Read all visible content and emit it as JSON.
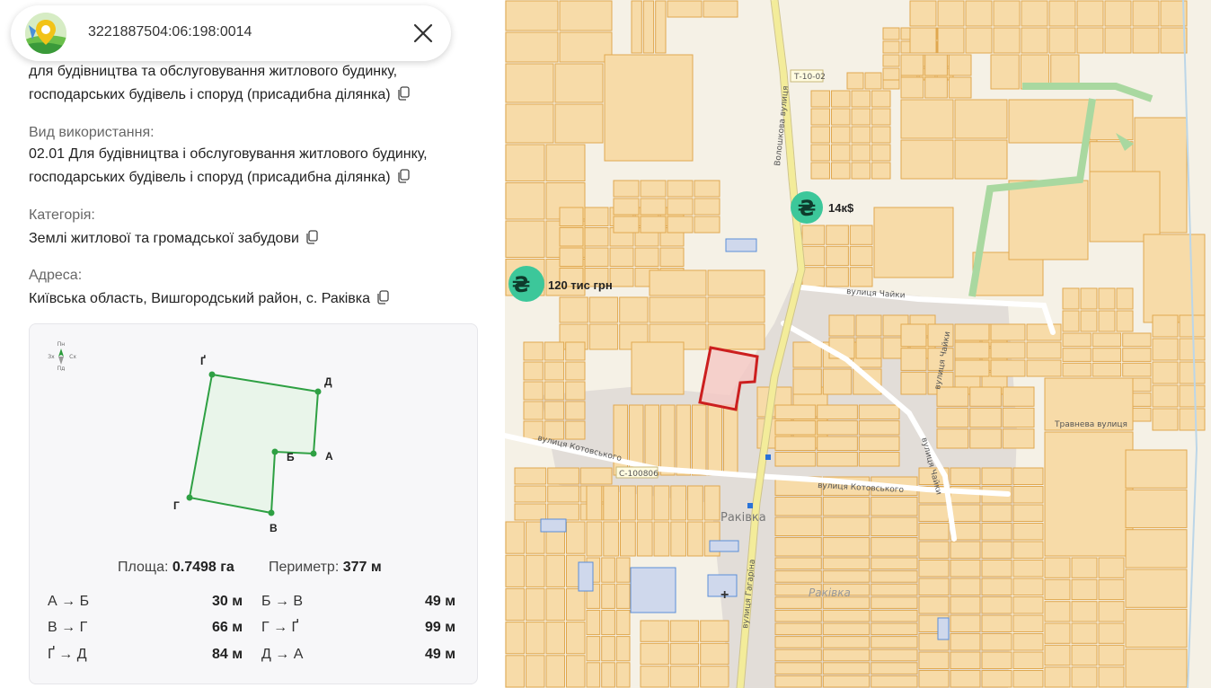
{
  "search": {
    "cadastral_number": "3221887504:06:198:0014"
  },
  "purpose": {
    "line1": "для будівництва та обслуговування житлового будинку,",
    "line2": "господарських будівель і споруд (присадибна ділянка)"
  },
  "usage": {
    "label": "Вид використання:",
    "line1": "02.01 Для будівництва і обслуговування житлового будинку,",
    "line2": "господарських будівель і споруд (присадибна ділянка)"
  },
  "category": {
    "label": "Категорія:",
    "value": "Землі житлової та громадської забудови"
  },
  "address": {
    "label": "Адреса:",
    "value": "Київська область, Вишгородський район, с. Раківка"
  },
  "compass": {
    "n": "Пн",
    "s": "Пд",
    "w": "Зх",
    "e": "Сх"
  },
  "vertices": {
    "a": "А",
    "b": "Б",
    "v": "В",
    "g": "Г",
    "gg": "Ґ",
    "d": "Д"
  },
  "stats": {
    "area_label": "Площа:",
    "area_value": "0.7498 га",
    "perimeter_label": "Периметр:",
    "perimeter_value": "377 м"
  },
  "segments": [
    {
      "from_to": "А → Б",
      "length": "30 м"
    },
    {
      "from_to": "Б → В",
      "length": "49 м"
    },
    {
      "from_to": "В → Г",
      "length": "66 м"
    },
    {
      "from_to": "Г → Ґ",
      "length": "99 м"
    },
    {
      "from_to": "Ґ → Д",
      "length": "84 м"
    },
    {
      "from_to": "Д → А",
      "length": "49 м"
    }
  ],
  "map": {
    "price_markers": [
      {
        "symbol": "₴",
        "label": "14к$"
      },
      {
        "symbol": "₴",
        "label": "120 тис грн"
      }
    ],
    "road_labels": {
      "t1002": "Т-10-02",
      "voloshkova": "Волошкова вулиця",
      "chaiky": "вулиця Чайки",
      "chaiky2": "вулиця Чайки",
      "trav": "Травнева вулиця",
      "kotov_w": "вулиця Котовського",
      "c100806": "С-100806",
      "kotov_e": "вулиця Котовського",
      "gagarina": "вулиця Гагаріна",
      "chaiky3": "вулиця Чайки"
    },
    "place_labels": {
      "rakivka": "Раківка",
      "rakivka2": "Раківка"
    },
    "colors": {
      "parcel_fill": "#f7dba8",
      "parcel_stroke": "#e0a850",
      "selected": "#cc1f1f",
      "road": "#f3ec9a",
      "green": "#a9d8a0",
      "marker": "#3cc79a"
    }
  }
}
